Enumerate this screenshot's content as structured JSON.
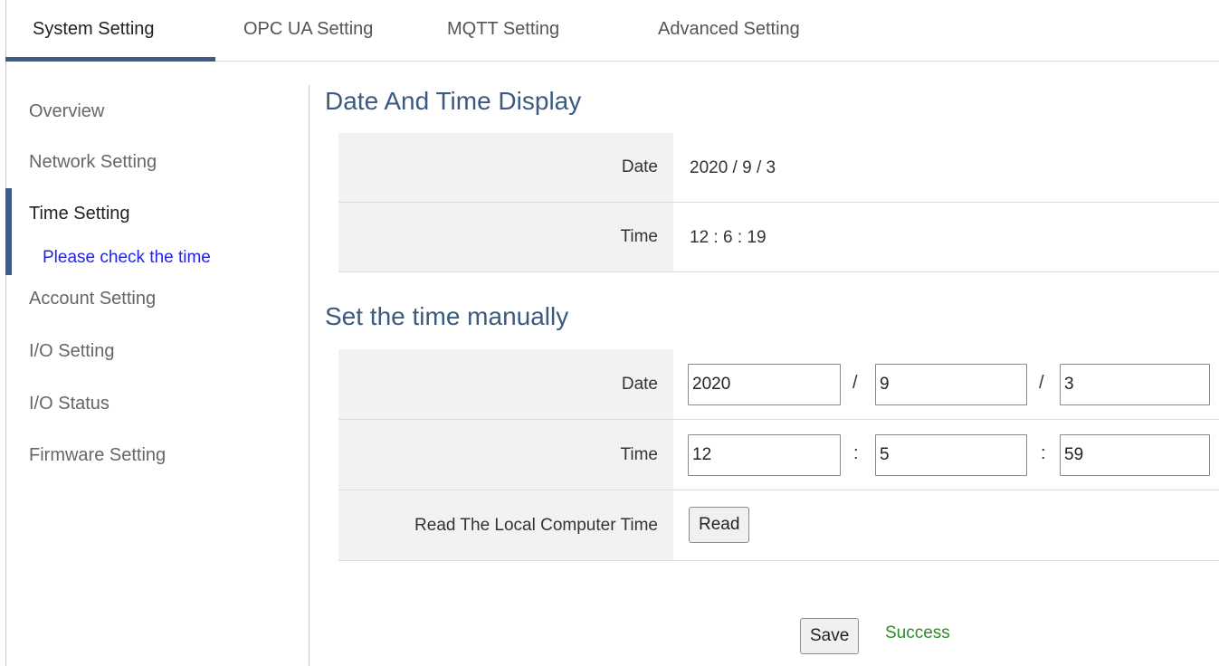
{
  "tabs": [
    {
      "label": "System Setting",
      "active": true
    },
    {
      "label": "OPC UA Setting",
      "active": false
    },
    {
      "label": "MQTT Setting",
      "active": false
    },
    {
      "label": "Advanced Setting",
      "active": false
    }
  ],
  "sidebar": {
    "items": [
      {
        "label": "Overview"
      },
      {
        "label": "Network Setting"
      },
      {
        "label": "Time Setting",
        "active": true
      },
      {
        "label": "Account Setting"
      },
      {
        "label": "I/O Setting"
      },
      {
        "label": "I/O Status"
      },
      {
        "label": "Firmware Setting"
      }
    ],
    "note": "Please check the time"
  },
  "display": {
    "heading": "Date And Time Display",
    "date_label": "Date",
    "date_value": "2020 / 9 / 3",
    "time_label": "Time",
    "time_value": "12 : 6 : 19"
  },
  "manual": {
    "heading": "Set the time manually",
    "date_label": "Date",
    "year": "2020",
    "month": "9",
    "day": "3",
    "date_sep": "/",
    "time_label": "Time",
    "hour": "12",
    "minute": "5",
    "second": "59",
    "time_sep": ":",
    "read_label": "Read The Local Computer Time",
    "read_button": "Read"
  },
  "footer": {
    "save_button": "Save",
    "status": "Success"
  },
  "colors": {
    "accent": "#3e5b85",
    "heading": "#3c5a80",
    "note": "#2323e6",
    "success": "#2e8b2e",
    "label_bg": "#f2f2f2"
  }
}
